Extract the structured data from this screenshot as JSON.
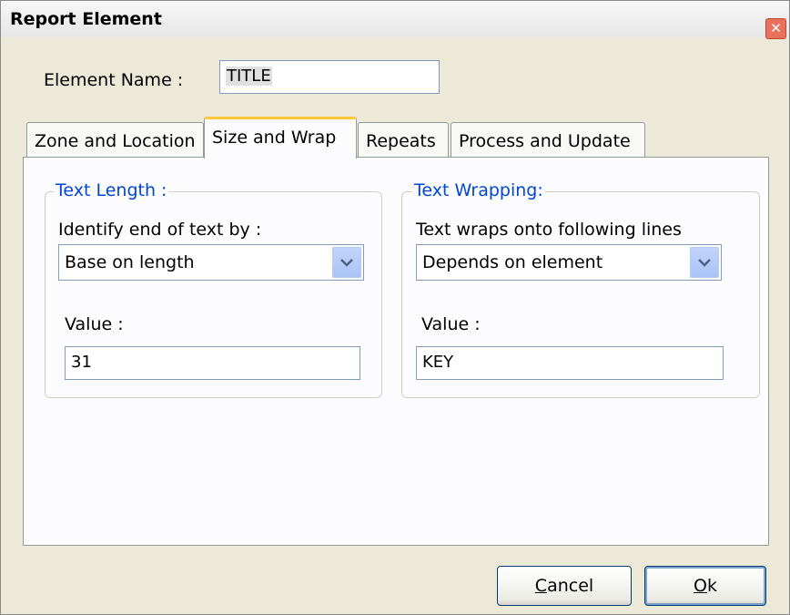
{
  "window": {
    "title": "Report Element",
    "close_icon": "close-icon"
  },
  "element_name": {
    "label": "Element Name :",
    "value": "TITLE"
  },
  "tabs": [
    {
      "label": "Zone and Location",
      "active": false
    },
    {
      "label": "Size and Wrap",
      "active": true
    },
    {
      "label": "Repeats",
      "active": false
    },
    {
      "label": "Process and Update",
      "active": false
    }
  ],
  "text_length": {
    "legend": "Text Length :",
    "identify_label": "Identify end of text by :",
    "identify_value": "Base on length",
    "value_label": "Value :",
    "value": "31"
  },
  "text_wrapping": {
    "legend": "Text Wrapping:",
    "wrap_label": "Text wraps onto following lines",
    "wrap_value": "Depends on element",
    "value_label": "Value :",
    "value": "KEY"
  },
  "buttons": {
    "cancel_first": "C",
    "cancel_rest": "ancel",
    "ok_first": "O",
    "ok_rest": "k"
  },
  "colors": {
    "accent_tab": "#ffc83c",
    "legend_text": "#0046d5",
    "close": "#e8725e"
  }
}
